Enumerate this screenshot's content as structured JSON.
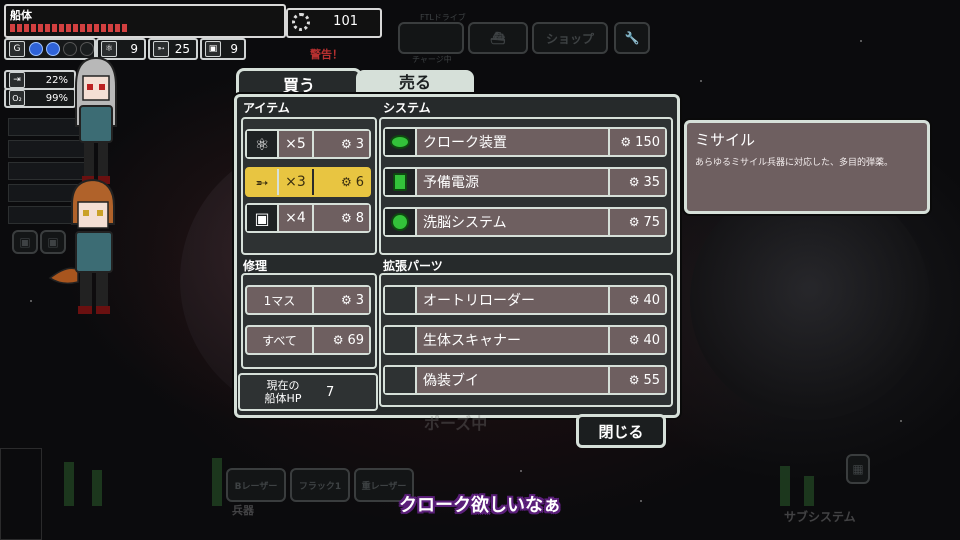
{
  "hud": {
    "hull_label": "船体",
    "hull_segments": 17,
    "scrap": "101",
    "fuel": "9",
    "missiles": "25",
    "drones": "9",
    "oxygen_label": "O₂",
    "evade_pct": "22%",
    "oxygen_pct": "99%",
    "warning_text": "警告！",
    "ftl_label": "FTLドライブ",
    "charge_label": "チャージ中",
    "shop_button": "ショップ",
    "pause_text": "ポーズ中",
    "weapons_label": "兵器",
    "subsystems_label": "サブシステム",
    "weapon_slots": [
      "Bレーザー",
      "フラック1",
      "重レーザー"
    ]
  },
  "store": {
    "tab_buy": "買う",
    "tab_sell": "売る",
    "items_title": "アイテム",
    "items": [
      {
        "icon": "fuel-icon",
        "qty": "×5",
        "price": "3",
        "selected": false
      },
      {
        "icon": "missile-icon",
        "qty": "×3",
        "price": "6",
        "selected": true
      },
      {
        "icon": "drone-part-icon",
        "qty": "×4",
        "price": "8",
        "selected": false
      }
    ],
    "systems_title": "システム",
    "systems": [
      {
        "icon": "cloak-icon",
        "name": "クローク装置",
        "price": "150"
      },
      {
        "icon": "battery-icon",
        "name": "予備電源",
        "price": "35"
      },
      {
        "icon": "mind-control-icon",
        "name": "洗脳システム",
        "price": "75"
      }
    ],
    "repair_title": "修理",
    "repair": [
      {
        "label": "1マス",
        "price": "3"
      },
      {
        "label": "すべて",
        "price": "69"
      }
    ],
    "hp_label_line1": "現在の",
    "hp_label_line2": "船体HP",
    "hp_value": "7",
    "augments_title": "拡張パーツ",
    "augments": [
      {
        "name": "オートリローダー",
        "price": "40"
      },
      {
        "name": "生体スキャナー",
        "price": "40"
      },
      {
        "name": "偽装ブイ",
        "price": "55"
      }
    ],
    "close_label": "閉じる",
    "currency_icon": "⚙"
  },
  "info": {
    "title": "ミサイル",
    "description": "あらゆるミサイル兵器に対応した、多目的弾薬。"
  },
  "subtitle": "クローク欲しいなぁ",
  "colors": {
    "panel_bg": "#262a2b",
    "border": "#d6e0d9",
    "row_bg": "#6e5f60",
    "selected": "#e8c541",
    "hull_red": "#d24040",
    "subtitle_outline": "#5b1f7a"
  }
}
